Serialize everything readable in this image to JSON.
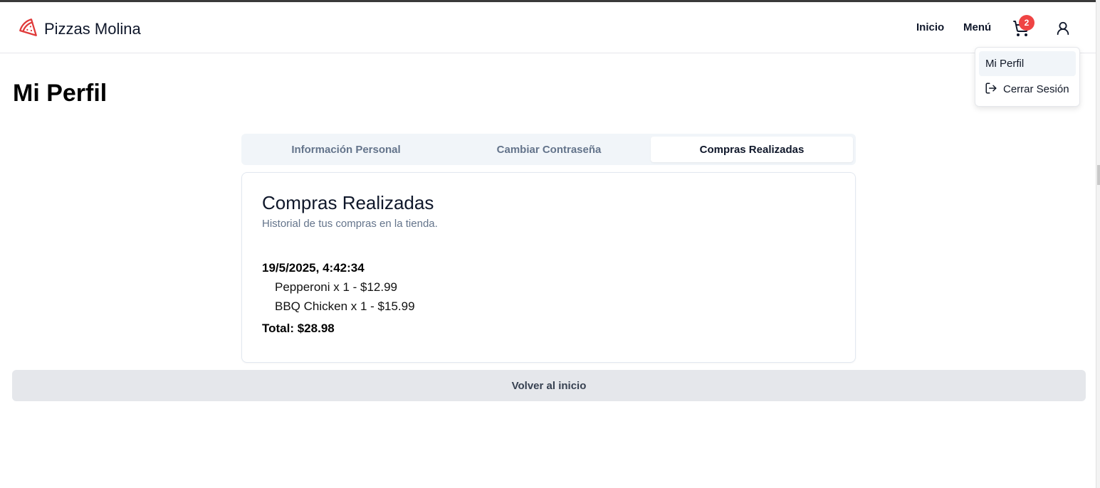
{
  "brand": {
    "name": "Pizzas Molina",
    "icon": "pizza-slice-icon",
    "color": "#e03a3a"
  },
  "nav": {
    "home_label": "Inicio",
    "menu_label": "Menú",
    "cart_count": "2",
    "cart_icon": "cart-icon",
    "user_icon": "user-icon"
  },
  "user_menu": {
    "profile_label": "Mi Perfil",
    "logout_label": "Cerrar Sesión",
    "logout_icon": "logout-icon"
  },
  "page": {
    "title": "Mi Perfil"
  },
  "tabs": [
    {
      "label": "Información Personal",
      "active": false
    },
    {
      "label": "Cambiar Contraseña",
      "active": false
    },
    {
      "label": "Compras Realizadas",
      "active": true
    }
  ],
  "purchases": {
    "title": "Compras Realizadas",
    "subtitle": "Historial de tus compras en la tienda.",
    "orders": [
      {
        "date": "19/5/2025, 4:42:34",
        "items": [
          "Pepperoni x 1 - $12.99",
          "BBQ Chicken x 1 - $15.99"
        ],
        "total": "Total: $28.98"
      }
    ]
  },
  "back_button": {
    "label": "Volver al inicio"
  },
  "colors": {
    "badge": "#ef4444",
    "tab_bg": "#f1f5f9",
    "button_bg": "#e5e7eb"
  }
}
